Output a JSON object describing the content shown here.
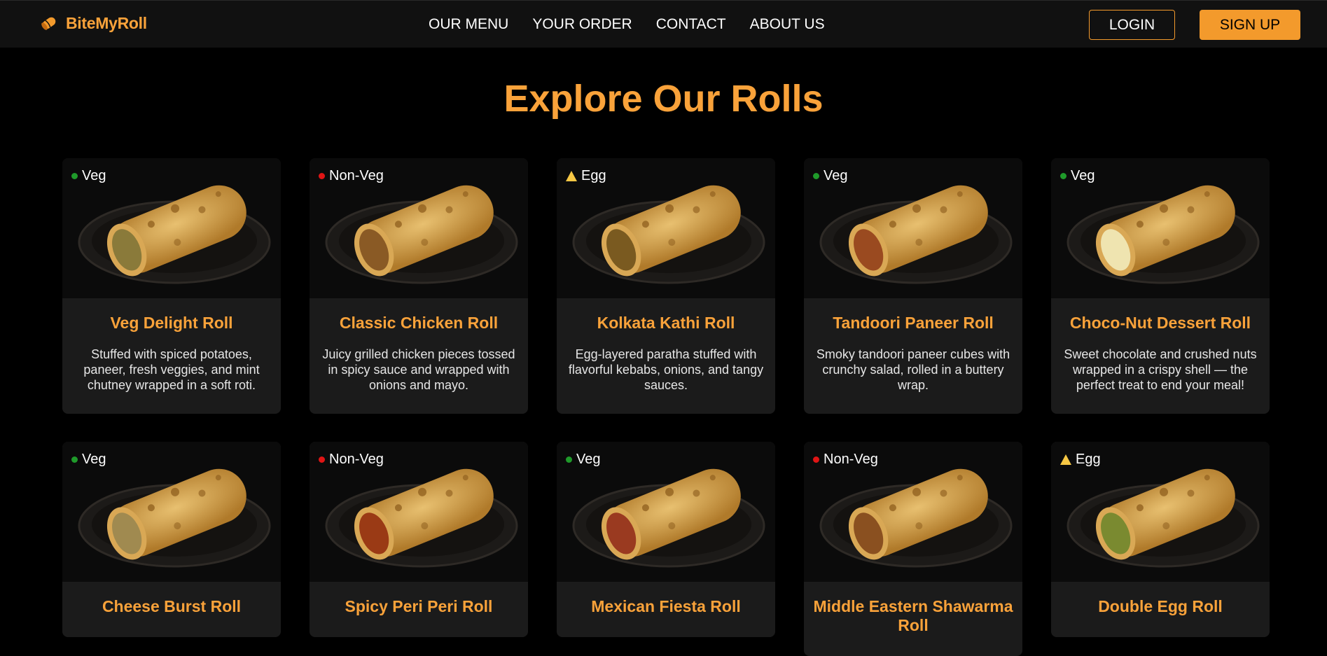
{
  "brand": {
    "name": "BiteMyRoll",
    "icon": "roll-logo-icon"
  },
  "nav": {
    "items": [
      "OUR MENU",
      "YOUR ORDER",
      "CONTACT",
      "ABOUT US"
    ]
  },
  "auth": {
    "login": "LOGIN",
    "signup": "SIGN UP"
  },
  "colors": {
    "accent": "#f39a2c",
    "veg": "#1f9a2a",
    "nonveg": "#e01515",
    "egg": "#f6c744"
  },
  "page_title": "Explore Our Rolls",
  "rolls": [
    {
      "name": "Veg Delight Roll",
      "type": "Veg",
      "desc": "Stuffed with spiced potatoes, paneer, fresh veggies, and mint chutney wrapped in a soft roti.",
      "filling": "#8a7a3a"
    },
    {
      "name": "Classic Chicken Roll",
      "type": "Non-Veg",
      "desc": "Juicy grilled chicken pieces tossed in spicy sauce and wrapped with onions and mayo.",
      "filling": "#8a5a25"
    },
    {
      "name": "Kolkata Kathi Roll",
      "type": "Egg",
      "desc": "Egg-layered paratha stuffed with flavorful kebabs, onions, and tangy sauces.",
      "filling": "#7a5a20"
    },
    {
      "name": "Tandoori Paneer Roll",
      "type": "Veg",
      "desc": "Smoky tandoori paneer cubes with crunchy salad, rolled in a buttery wrap.",
      "filling": "#9a4a20"
    },
    {
      "name": "Choco-Nut Dessert Roll",
      "type": "Veg",
      "desc": "Sweet chocolate and crushed nuts wrapped in a crispy shell — the perfect treat to end your meal!",
      "filling": "#efe4b0"
    },
    {
      "name": "Cheese Burst Roll",
      "type": "Veg",
      "desc": "",
      "filling": "#a08a50"
    },
    {
      "name": "Spicy Peri Peri Roll",
      "type": "Non-Veg",
      "desc": "",
      "filling": "#9a3a15"
    },
    {
      "name": "Mexican Fiesta Roll",
      "type": "Veg",
      "desc": "",
      "filling": "#9a3a20"
    },
    {
      "name": "Middle Eastern Shawarma Roll",
      "type": "Non-Veg",
      "desc": "",
      "filling": "#8a5020"
    },
    {
      "name": "Double Egg Roll",
      "type": "Egg",
      "desc": "",
      "filling": "#7a8a30"
    }
  ]
}
